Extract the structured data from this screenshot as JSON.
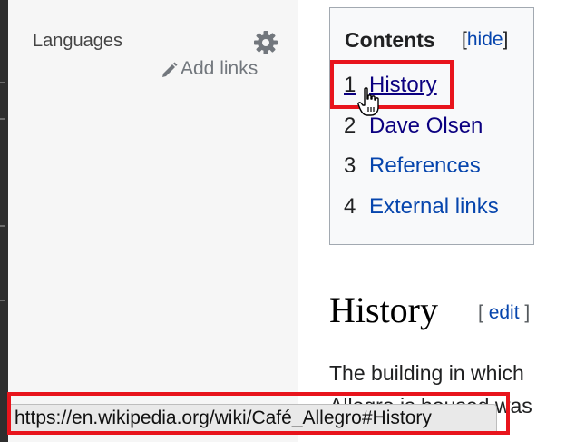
{
  "sidebar": {
    "languages_label": "Languages",
    "add_links_label": "Add links"
  },
  "toc": {
    "title": "Contents",
    "toggle_open": "[",
    "toggle_label": "hide",
    "toggle_close": "]",
    "items": [
      {
        "number": "1",
        "label": "History"
      },
      {
        "number": "2",
        "label": "Dave Olsen"
      },
      {
        "number": "3",
        "label": "References"
      },
      {
        "number": "4",
        "label": "External links"
      }
    ]
  },
  "content": {
    "heading": "History",
    "edit_open": "[",
    "edit_label": "edit",
    "edit_close": "]",
    "paragraph_line1": "The building in which",
    "paragraph_line2": "Allegro is housed was"
  },
  "status_bar": {
    "url": "https://en.wikipedia.org/wiki/Café_Allegro#History"
  },
  "colors": {
    "link": "#0645ad",
    "visited_link": "#0b0080",
    "annotation_red": "#e8141c"
  }
}
